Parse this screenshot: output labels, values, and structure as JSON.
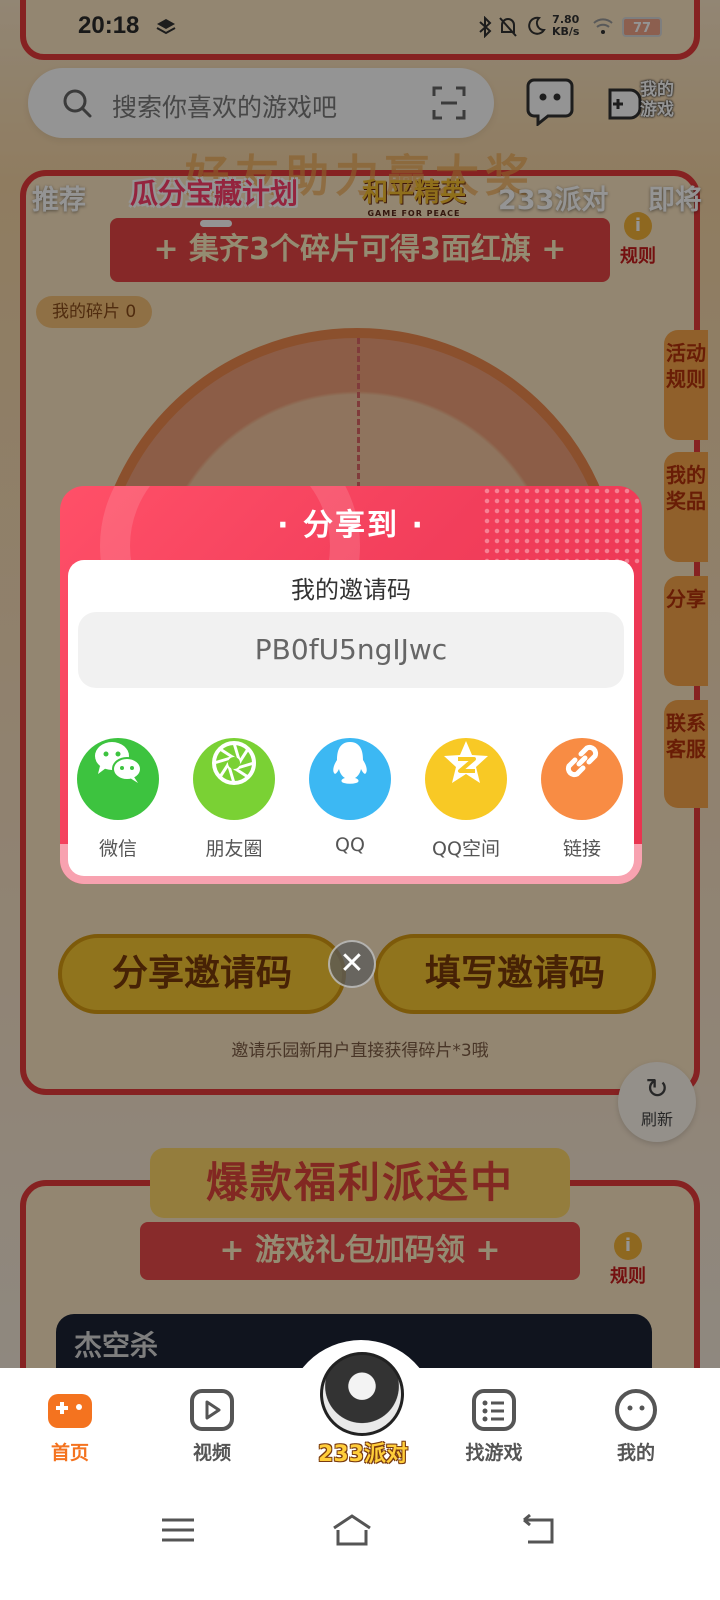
{
  "status_bar": {
    "time": "20:18",
    "net_speed_value": "7.80",
    "net_speed_unit": "KB/s",
    "battery": "77"
  },
  "search": {
    "placeholder": "搜索你喜欢的游戏吧"
  },
  "header": {
    "my_games_label": "我的游戏"
  },
  "tabs": [
    {
      "label": "推荐"
    },
    {
      "label": "瓜分宝藏计划"
    },
    {
      "label": "和平精英",
      "sub": "GAME FOR PEACE"
    },
    {
      "label": "233派对"
    },
    {
      "label": "即将"
    }
  ],
  "background": {
    "banner_title": "好友助力赢大奖",
    "ribbon": "+ 集齐3个碎片可得3面红旗 +",
    "rule_badge": "规则",
    "fragments": "我的碎片 0",
    "side_tabs": [
      "活动规则",
      "我的奖品",
      "分享",
      "联系客服"
    ],
    "share_code_button": "分享邀请码",
    "fill_code_button": "填写邀请码",
    "hint": "邀请乐园新用户直接获得碎片*3哦",
    "refresh_label": "刷新",
    "hot_title": "爆款福利派送中",
    "hot_ribbon": "+ 游戏礼包加码领 +",
    "hot_rule_badge": "规则",
    "game_card_title": "杰空杀"
  },
  "dialog": {
    "title": "· 分享到 ·",
    "invite_label": "我的邀请码",
    "invite_code": "PB0fU5ngIJwc",
    "share_options": [
      {
        "label": "微信",
        "icon": "wechat-icon",
        "color": "#3dc33f"
      },
      {
        "label": "朋友圈",
        "icon": "moments-icon",
        "color": "#7ad134"
      },
      {
        "label": "QQ",
        "icon": "qq-icon",
        "color": "#3cb8f3"
      },
      {
        "label": "QQ空间",
        "icon": "qzone-icon",
        "color": "#f8c925"
      },
      {
        "label": "链接",
        "icon": "link-icon",
        "color": "#f88c44"
      }
    ],
    "close_symbol": "✕"
  },
  "bottom_nav": {
    "items": [
      {
        "label": "首页",
        "active": true,
        "accent": "#f4731f"
      },
      {
        "label": "视频"
      },
      {
        "label": "233派对"
      },
      {
        "label": "找游戏"
      },
      {
        "label": "我的"
      }
    ]
  }
}
